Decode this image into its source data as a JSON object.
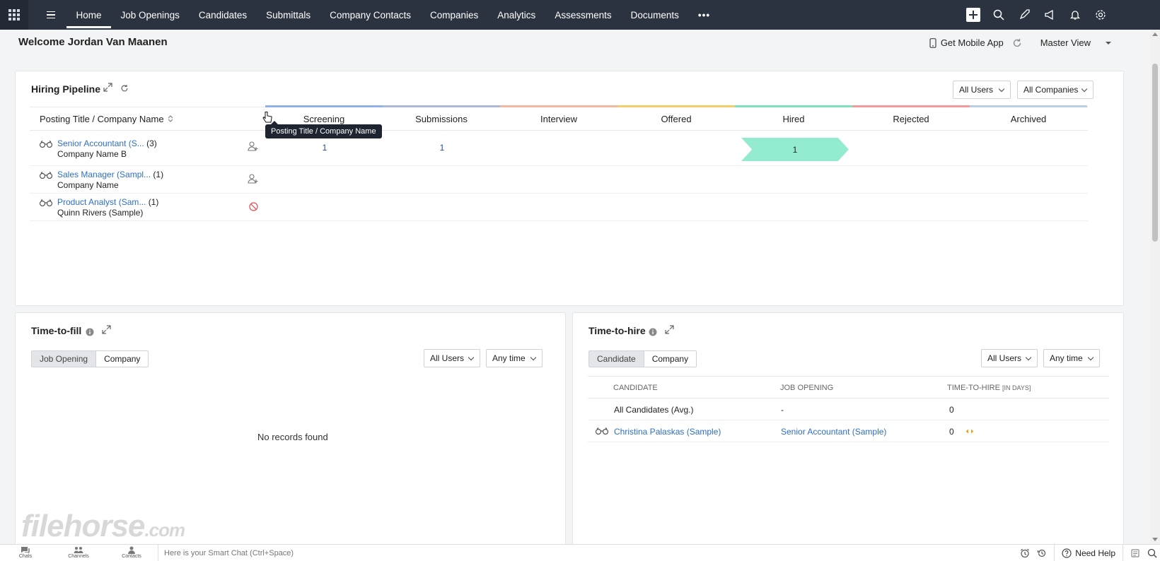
{
  "nav": {
    "tabs": [
      "Home",
      "Job Openings",
      "Candidates",
      "Submittals",
      "Company Contacts",
      "Companies",
      "Analytics",
      "Assessments",
      "Documents"
    ],
    "more": "•••"
  },
  "welcome": {
    "title": "Welcome Jordan Van Maanen",
    "mobile_app": "Get Mobile App",
    "view": "Master View"
  },
  "pipeline": {
    "title": "Hiring Pipeline",
    "filter_users": "All Users",
    "filter_companies": "All Companies",
    "column_title": "Posting Title / Company Name",
    "tooltip": "Posting Title / Company Name",
    "stages": [
      {
        "label": "Screening",
        "color": "#8fb0e8"
      },
      {
        "label": "Submissions",
        "color": "#a9b9d6"
      },
      {
        "label": "Interview",
        "color": "#f0b8a0"
      },
      {
        "label": "Offered",
        "color": "#f2cf6b"
      },
      {
        "label": "Hired",
        "color": "#7fe0c0"
      },
      {
        "label": "Rejected",
        "color": "#f29a9a"
      },
      {
        "label": "Archived",
        "color": "#b8cde6"
      }
    ],
    "rows": [
      {
        "job": "Senior Accountant (S...",
        "count": "(3)",
        "company": "Company Name B",
        "screening": "1",
        "submissions": "1",
        "hired": "1"
      },
      {
        "job": "Sales Manager (Sampl...",
        "count": "(1)",
        "company": "Company Name"
      },
      {
        "job": "Product Analyst (Sam...",
        "count": "(1)",
        "company": "Quinn Rivers (Sample)"
      }
    ]
  },
  "time_to_fill": {
    "title": "Time-to-fill",
    "toggle_a": "Job Opening",
    "toggle_b": "Company",
    "filter_users": "All Users",
    "filter_time": "Any time",
    "empty": "No records found"
  },
  "time_to_hire": {
    "title": "Time-to-hire",
    "toggle_a": "Candidate",
    "toggle_b": "Company",
    "filter_users": "All Users",
    "filter_time": "Any time",
    "headers": {
      "candidate": "Candidate",
      "job": "Job Opening",
      "tth": "Time-to-hire",
      "tth_unit": "[in days]"
    },
    "rows": [
      {
        "candidate": "All Candidates (Avg.)",
        "job": "-",
        "value": "0"
      },
      {
        "candidate": "Christina Palaskas (Sample)",
        "job": "Senior Accountant (Sample)",
        "value": "0"
      }
    ]
  },
  "bottom": {
    "chats": "Chats",
    "channels": "Channels",
    "contacts": "Contacts",
    "smartchat": "Here is your Smart Chat (Ctrl+Space)",
    "help": "Need Help"
  },
  "watermark": {
    "main": "filehorse",
    "suffix": ".com"
  }
}
